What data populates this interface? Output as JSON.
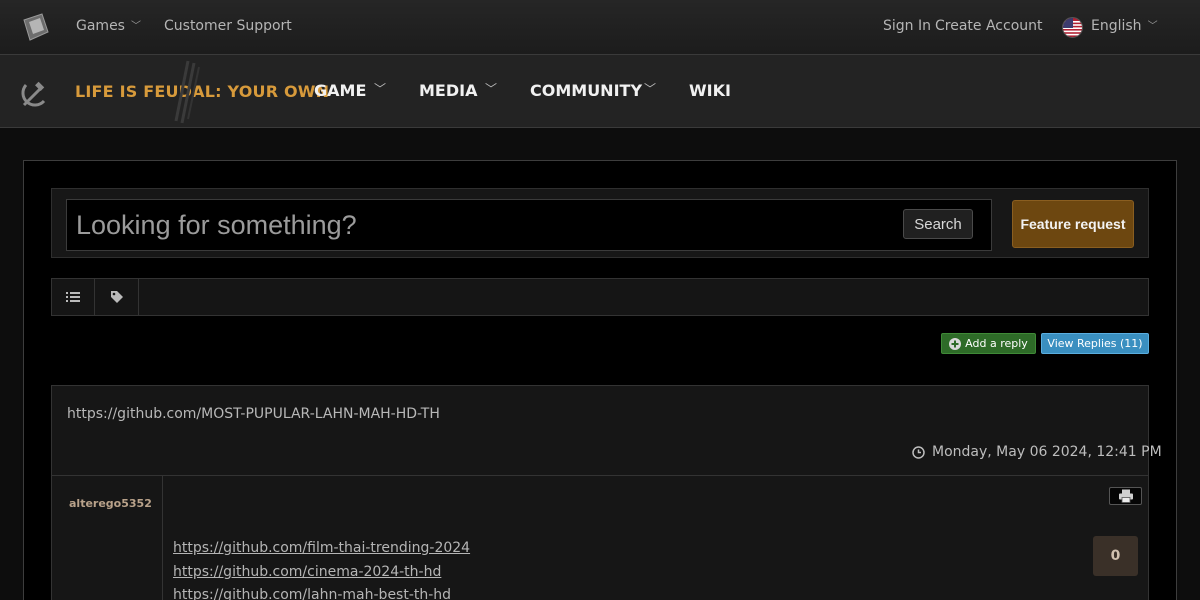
{
  "topbar": {
    "games_label": "Games",
    "support_label": "Customer Support",
    "signin_label": "Sign In",
    "create_label": "Create Account",
    "language_label": "English"
  },
  "nav": {
    "brand": "LIFE IS FEUDAL: YOUR OWN",
    "items": [
      {
        "label": "GAME",
        "has_dropdown": true
      },
      {
        "label": "MEDIA",
        "has_dropdown": true
      },
      {
        "label": "COMMUNITY",
        "has_dropdown": true
      },
      {
        "label": "WIKI",
        "has_dropdown": false
      }
    ]
  },
  "search": {
    "placeholder": "Looking for something?",
    "button_label": "Search",
    "feature_label": "Feature request"
  },
  "toolbar": {
    "icons": [
      "list-icon",
      "tag-icon"
    ]
  },
  "actions": {
    "add_reply_label": "Add a reply",
    "view_replies_label": "View Replies (11)"
  },
  "post": {
    "title": "https://github.com/MOST-PUPULAR-LAHN-MAH-HD-TH",
    "date": "Monday, May 06 2024, 12:41 PM",
    "author": "alterego5352",
    "links": [
      "https://github.com/film-thai-trending-2024",
      "https://github.com/cinema-2024-th-hd",
      "https://github.com/lahn-mah-best-th-hd"
    ],
    "votes": "0"
  },
  "colors": {
    "brand_accent": "#d79a3b",
    "feature_button": "#6d4710",
    "add_reply_green": "#2e6b28",
    "view_replies_blue": "#3a8fc0"
  }
}
